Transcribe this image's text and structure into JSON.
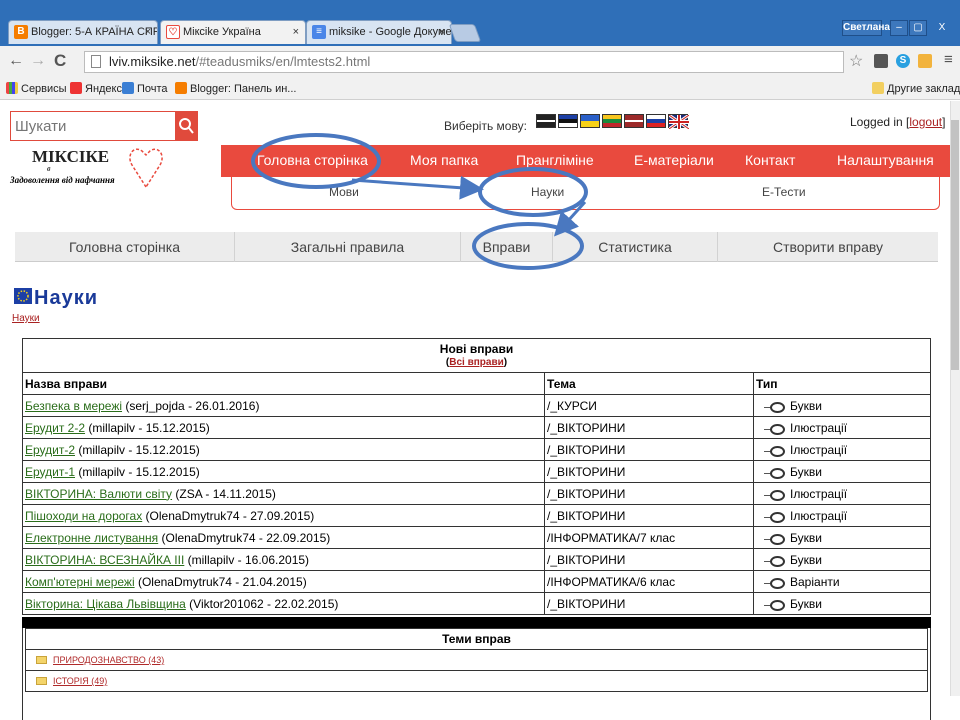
{
  "browser": {
    "tabs": [
      {
        "title": "Blogger: 5-А КРАЇНА СПР",
        "icon": "B",
        "color": "#f57d00"
      },
      {
        "title": "Мікcike Україна",
        "icon": "♡",
        "color": "#e94a3e"
      },
      {
        "title": "miksike - Google Докумен",
        "icon": "≡",
        "color": "#4a86e8"
      }
    ],
    "user": "Светлана",
    "url_host": "lviv.miksike.net",
    "url_path": "/#teadusmiks/en/lmtests2.html",
    "bookmarks": [
      "Сервисы",
      "Яндекс",
      "Почта",
      "Blogger: Панель ин..."
    ],
    "other_bookmarks": "Другие закладки"
  },
  "header": {
    "search_placeholder": "Шукати",
    "logo_title": "МІКСІКЕ",
    "logo_v": "в",
    "logo_tagline": "Задоволення від нафчання",
    "lang_label": "Виберіть мову:",
    "logged_in": "Logged in [",
    "logout": "logout",
    "logged_in_end": "]"
  },
  "mainnav": [
    "Головна сторінка",
    "Моя папка",
    "Прангліміне",
    "Е-матеріали",
    "Контакт",
    "Налаштування"
  ],
  "subnav": [
    "Мови",
    "Науки",
    "Е-Тести"
  ],
  "tabsbar": [
    "Головна сторінка",
    "Загальні правила",
    "Вправи",
    "Статистика",
    "Створити вправу"
  ],
  "section": {
    "title": "Науки",
    "crumb": "Науки"
  },
  "table": {
    "caption": "Нові вправи",
    "all_link": "Всі вправи",
    "headers": [
      "Назва вправи",
      "Тема",
      "Тип"
    ],
    "rows": [
      {
        "name": "Безпека в мережі",
        "meta": " (serj_pojda - 26.01.2016)",
        "topic": "/_КУРСИ",
        "type": "Букви"
      },
      {
        "name": "Ерудит 2-2",
        "meta": " (millapilv - 15.12.2015)",
        "topic": "/_ВІКТОРИНИ",
        "type": "Ілюстрації"
      },
      {
        "name": "Ерудит-2",
        "meta": " (millapilv - 15.12.2015)",
        "topic": "/_ВІКТОРИНИ",
        "type": "Ілюстрації"
      },
      {
        "name": "Ерудит-1",
        "meta": " (millapilv - 15.12.2015)",
        "topic": "/_ВІКТОРИНИ",
        "type": "Букви"
      },
      {
        "name": "ВІКТОРИНА: Валюти світу",
        "meta": " (ZSA - 14.11.2015)",
        "topic": "/_ВІКТОРИНИ",
        "type": "Ілюстрації"
      },
      {
        "name": "Пішоходи на дорогах",
        "meta": " (OlenaDmytruk74 - 27.09.2015)",
        "topic": "/_ВІКТОРИНИ",
        "type": "Ілюстрації"
      },
      {
        "name": "Електронне листування",
        "meta": " (OlenaDmytruk74 - 22.09.2015)",
        "topic": "/ІНФОРМАТИКА/7 клас",
        "type": "Букви"
      },
      {
        "name": "ВІКТОРИНА: ВСЕЗНАЙКА ІІІ",
        "meta": " (millapilv - 16.06.2015)",
        "topic": "/_ВІКТОРИНИ",
        "type": "Букви"
      },
      {
        "name": "Комп'ютерні мережі",
        "meta": " (OlenaDmytruk74 - 21.04.2015)",
        "topic": "/ІНФОРМАТИКА/6 клас",
        "type": "Варіанти"
      },
      {
        "name": "Вікторина: Цікава Львівщина",
        "meta": " (Viktor201062 - 22.02.2015)",
        "topic": "/_ВІКТОРИНИ",
        "type": "Букви"
      }
    ]
  },
  "topics": {
    "title": "Теми вправ",
    "items": [
      "ПРИРОДОЗНАВСТВО (43)",
      "ІСТОРІЯ (49)"
    ]
  },
  "colors": {
    "accent": "#e94a3e",
    "annotation": "#4a78c0"
  }
}
